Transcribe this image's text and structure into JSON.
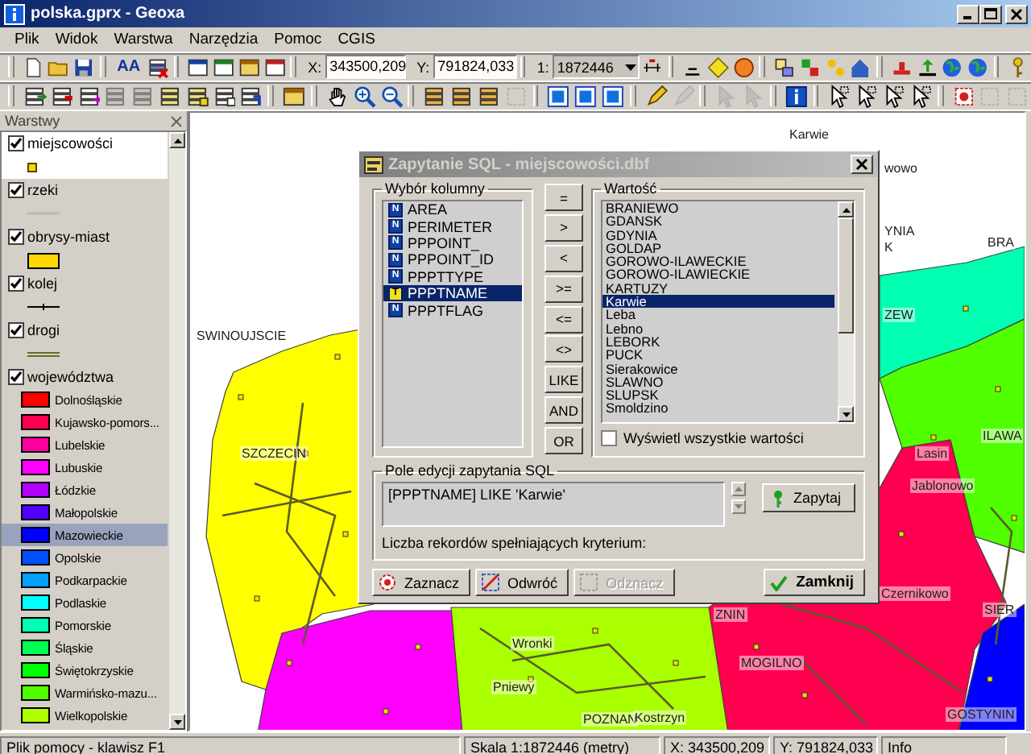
{
  "window": {
    "title": "polska.gprx - Geoxa"
  },
  "menu": [
    "Plik",
    "Widok",
    "Warstwa",
    "Narzędzia",
    "Pomoc",
    "CGIS"
  ],
  "toolbar": {
    "font_button": "AA",
    "x_label": "X:",
    "x_value": "343500,209",
    "y_label": "Y:",
    "y_value": "791824,033",
    "scale_label": "1:",
    "scale_value": "1872446"
  },
  "layers_panel": {
    "title": "Warstwy",
    "layers": [
      {
        "name": "miejscowości",
        "checked": true,
        "selected": true,
        "kind": "point"
      },
      {
        "name": "rzeki",
        "checked": true,
        "selected": false,
        "kind": "line"
      },
      {
        "name": "obrysy-miast",
        "checked": true,
        "selected": false,
        "kind": "fill"
      },
      {
        "name": "kolej",
        "checked": true,
        "selected": false,
        "kind": "rail"
      },
      {
        "name": "drogi",
        "checked": true,
        "selected": false,
        "kind": "double-line"
      },
      {
        "name": "województwa",
        "checked": true,
        "selected": false,
        "kind": "classes",
        "classes": [
          {
            "name": "Dolnośląskie",
            "color": "#ff0000",
            "selected": false
          },
          {
            "name": "Kujawsko-pomors...",
            "color": "#ff0050",
            "selected": false
          },
          {
            "name": "Lubelskie",
            "color": "#ff00a0",
            "selected": false
          },
          {
            "name": "Lubuskie",
            "color": "#ff00ff",
            "selected": false
          },
          {
            "name": "Łódzkie",
            "color": "#b000ff",
            "selected": false
          },
          {
            "name": "Małopolskie",
            "color": "#5000ff",
            "selected": false
          },
          {
            "name": "Mazowieckie",
            "color": "#0000ff",
            "selected": true
          },
          {
            "name": "Opolskie",
            "color": "#0050ff",
            "selected": false
          },
          {
            "name": "Podkarpackie",
            "color": "#00a0ff",
            "selected": false
          },
          {
            "name": "Podlaskie",
            "color": "#00ffff",
            "selected": false
          },
          {
            "name": "Pomorskie",
            "color": "#00ffb0",
            "selected": false
          },
          {
            "name": "Śląskie",
            "color": "#00ff50",
            "selected": false
          },
          {
            "name": "Świętokrzyskie",
            "color": "#00ff00",
            "selected": false
          },
          {
            "name": "Warmińsko-mazu...",
            "color": "#50ff00",
            "selected": false
          },
          {
            "name": "Wielkopolskie",
            "color": "#b0ff00",
            "selected": false
          }
        ]
      }
    ]
  },
  "map": {
    "labels": [
      "Karwie",
      "wowo",
      "YNIA",
      "K",
      "BRA",
      "ZEW",
      "SWINOUJSCIE",
      "SZCZECIN",
      "ILAWA",
      "Lasin",
      "Jablonowo",
      "Czernikowo",
      "ZNIN",
      "SIER",
      "Wronki",
      "MOGILNO",
      "Pniewy",
      "POZNAN",
      "Kostrzyn",
      "GOSTYNIN"
    ]
  },
  "dialog": {
    "title": "Zapytanie SQL - miejscowości.dbf",
    "columns_group": "Wybór kolumny",
    "columns": [
      {
        "type": "N",
        "name": "AREA",
        "selected": false
      },
      {
        "type": "N",
        "name": "PERIMETER",
        "selected": false
      },
      {
        "type": "N",
        "name": "PPPOINT_",
        "selected": false
      },
      {
        "type": "N",
        "name": "PPPOINT_ID",
        "selected": false
      },
      {
        "type": "N",
        "name": "PPPTTYPE",
        "selected": false
      },
      {
        "type": "T",
        "name": "PPPTNAME",
        "selected": true
      },
      {
        "type": "N",
        "name": "PPPTFLAG",
        "selected": false
      }
    ],
    "operators": [
      "=",
      ">",
      "<",
      ">=",
      "<=",
      "<>",
      "LIKE",
      "AND",
      "OR"
    ],
    "values_group": "Wartość",
    "values": [
      {
        "text": "BRANIEWO",
        "selected": false
      },
      {
        "text": "GDANSK",
        "selected": false
      },
      {
        "text": "GDYNIA",
        "selected": false
      },
      {
        "text": "GOLDAP",
        "selected": false
      },
      {
        "text": "GOROWO-ILAWECKIE",
        "selected": false
      },
      {
        "text": "GOROWO-ILAWIECKIE",
        "selected": false
      },
      {
        "text": "KARTUZY",
        "selected": false
      },
      {
        "text": "Karwie",
        "selected": true
      },
      {
        "text": "Leba",
        "selected": false
      },
      {
        "text": "Lebno",
        "selected": false
      },
      {
        "text": "LEBORK",
        "selected": false
      },
      {
        "text": "PUCK",
        "selected": false
      },
      {
        "text": "Sierakowice",
        "selected": false
      },
      {
        "text": "SLAWNO",
        "selected": false
      },
      {
        "text": "SLUPSK",
        "selected": false
      },
      {
        "text": "Smoldzino",
        "selected": false
      }
    ],
    "show_all": {
      "label": "Wyświetl wszystkie wartości",
      "checked": false
    },
    "query_group": "Pole edycji zapytania SQL",
    "query": "[PPPTNAME] LIKE 'Karwie'",
    "query_button": "Zapytaj",
    "count_label": "Liczba rekordów spełniających kryterium:",
    "buttons": [
      {
        "label": "Zaznacz",
        "kind": "select",
        "disabled": false
      },
      {
        "label": "Odwróć",
        "kind": "invert",
        "disabled": false
      },
      {
        "label": "Odznacz",
        "kind": "deselect",
        "disabled": true
      },
      {
        "label": "Zamknij",
        "kind": "close",
        "disabled": false
      }
    ]
  },
  "status_bar": [
    "Plik pomocy - klawisz F1",
    "Skala 1:1872446 (metry)",
    "X: 343500,209",
    "Y: 791824,033",
    "Info"
  ]
}
